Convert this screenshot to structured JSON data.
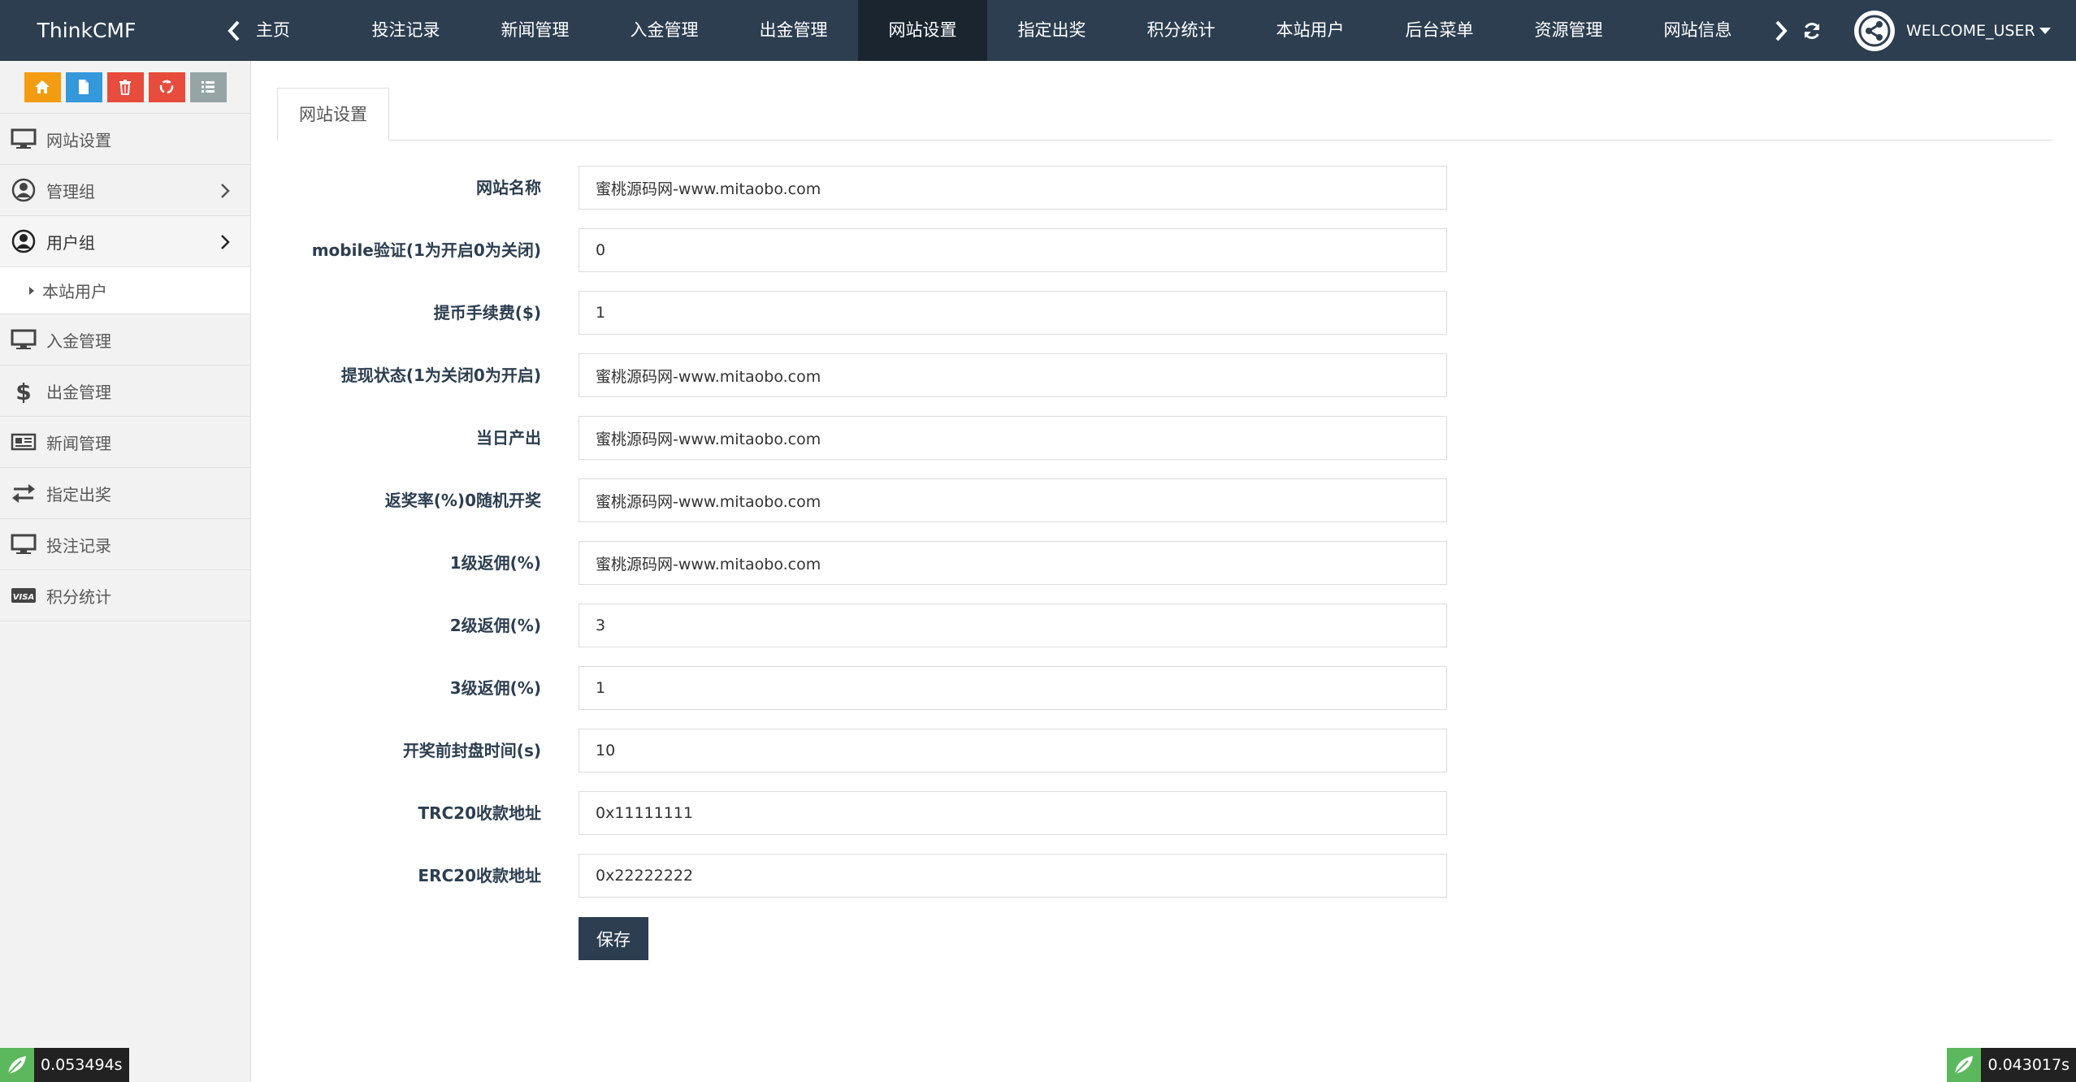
{
  "header": {
    "brand": "ThinkCMF",
    "home": "主页",
    "tabs": [
      "投注记录",
      "新闻管理",
      "入金管理",
      "出金管理",
      "网站设置",
      "指定出奖",
      "积分统计",
      "本站用户",
      "后台菜单",
      "资源管理",
      "网站信息"
    ],
    "active_tab": "网站设置",
    "user": "WELCOME_USER"
  },
  "shortcuts": [
    {
      "icon": "home-icon",
      "color": "#f39c12"
    },
    {
      "icon": "file-icon",
      "color": "#3498db"
    },
    {
      "icon": "trash-icon",
      "color": "#e74c3c"
    },
    {
      "icon": "recycle-icon",
      "color": "#e74c3c"
    },
    {
      "icon": "list-icon",
      "color": "#95a5a6"
    }
  ],
  "sidebar": {
    "items": [
      {
        "label": "网站设置",
        "icon": "monitor-icon"
      },
      {
        "label": "管理组",
        "icon": "user-circle-icon"
      },
      {
        "label": "用户组",
        "icon": "user-circle-icon"
      },
      {
        "label": "本站用户"
      },
      {
        "label": "入金管理",
        "icon": "monitor-icon"
      },
      {
        "label": "出金管理",
        "icon": "dollar-icon"
      },
      {
        "label": "新闻管理",
        "icon": "newspaper-icon"
      },
      {
        "label": "指定出奖",
        "icon": "exchange-icon"
      },
      {
        "label": "投注记录",
        "icon": "monitor-icon"
      },
      {
        "label": "积分统计",
        "icon": "visa-icon"
      }
    ]
  },
  "main": {
    "tab": "网站设置",
    "fields": [
      {
        "label": "网站名称",
        "value": "蜜桃源码网-www.mitaobo.com"
      },
      {
        "label": "mobile验证(1为开启0为关闭)",
        "value": "0"
      },
      {
        "label": "提币手续费($)",
        "value": "1"
      },
      {
        "label": "提现状态(1为关闭0为开启)",
        "value": "蜜桃源码网-www.mitaobo.com"
      },
      {
        "label": "当日产出",
        "value": "蜜桃源码网-www.mitaobo.com"
      },
      {
        "label": "返奖率(%)0随机开奖",
        "value": "蜜桃源码网-www.mitaobo.com"
      },
      {
        "label": "1级返佣(%)",
        "value": "蜜桃源码网-www.mitaobo.com"
      },
      {
        "label": "2级返佣(%)",
        "value": "3"
      },
      {
        "label": "3级返佣(%)",
        "value": "1"
      },
      {
        "label": "开奖前封盘时间(s)",
        "value": "10"
      },
      {
        "label": "TRC20收款地址",
        "value": "0x11111111"
      },
      {
        "label": "ERC20收款地址",
        "value": "0x22222222"
      }
    ],
    "save_label": "保存"
  },
  "debug": {
    "left_time": "0.053494s",
    "right_time": "0.043017s"
  }
}
